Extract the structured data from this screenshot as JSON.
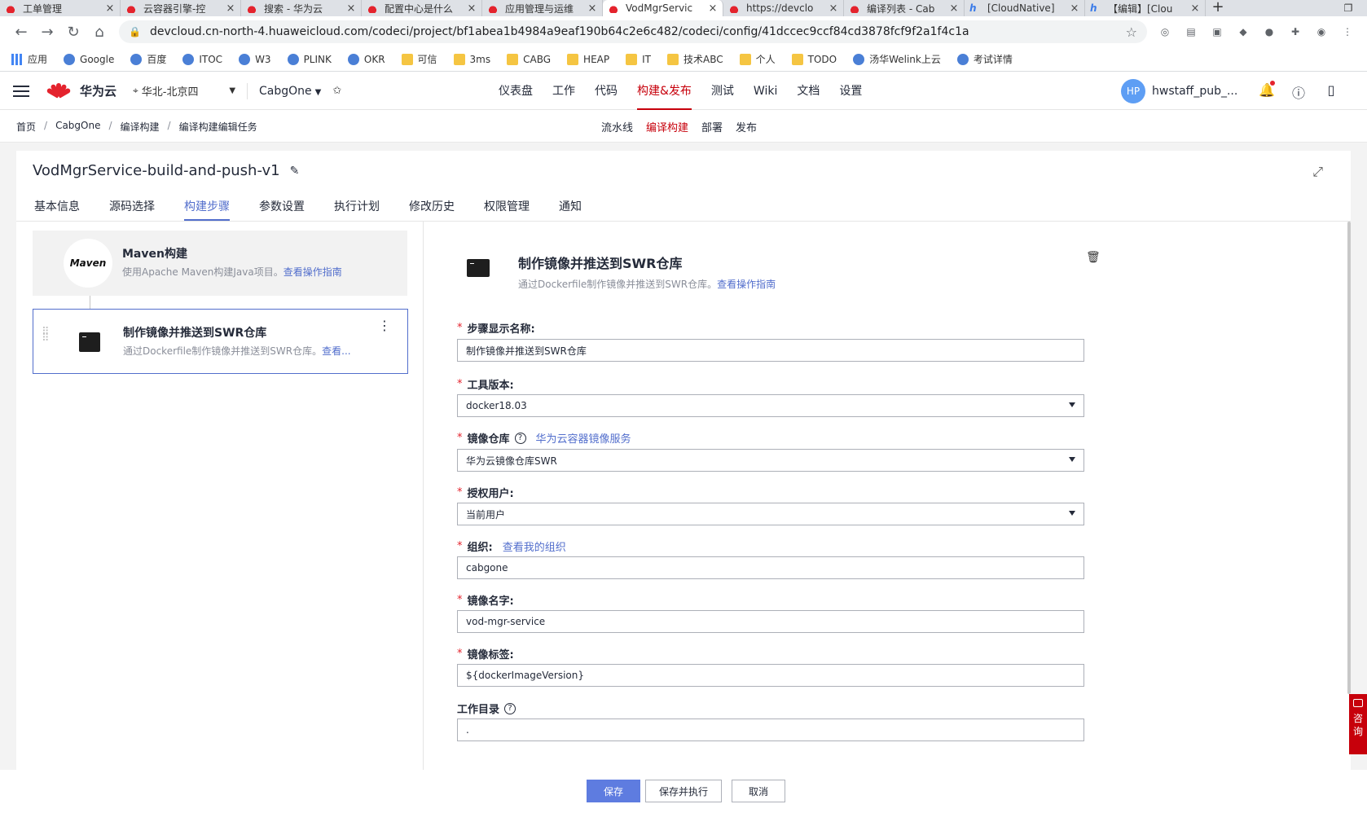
{
  "browser": {
    "tabs": [
      {
        "label": "工单管理",
        "icon": "huawei"
      },
      {
        "label": "云容器引擎-控",
        "icon": "huawei"
      },
      {
        "label": "搜索 - 华为云",
        "icon": "huawei"
      },
      {
        "label": "配置中心是什么",
        "icon": "huawei"
      },
      {
        "label": "应用管理与运维",
        "icon": "huawei"
      },
      {
        "label": "VodMgrServic",
        "icon": "huawei",
        "active": true
      },
      {
        "label": "https://devclo",
        "icon": "huawei"
      },
      {
        "label": "编译列表 - Cab",
        "icon": "huawei"
      },
      {
        "label": "[CloudNative]",
        "icon": "welink"
      },
      {
        "label": "【编辑】[Clou",
        "icon": "welink"
      }
    ],
    "url": "devcloud.cn-north-4.huaweicloud.com/codeci/project/bf1abea1b4984a9eaf190b64c2e6c482/codeci/config/41dccec9ccf84cd3878fcf9f2a1f4c1a",
    "bookmarks": [
      "应用",
      "Google",
      "百度",
      "ITOC",
      "W3",
      "PLINK",
      "OKR",
      "可信",
      "3ms",
      "CABG",
      "HEAP",
      "IT",
      "技术ABC",
      "个人",
      "TODO",
      "汤华Welink上云",
      "考试详情"
    ]
  },
  "header": {
    "brand": "华为云",
    "logo_caption": "HUAWEI",
    "region": "华北-北京四",
    "project": "CabgOne",
    "nav": [
      "仪表盘",
      "工作",
      "代码",
      "构建&发布",
      "测试",
      "Wiki",
      "文档",
      "设置"
    ],
    "nav_active": "构建&发布",
    "user_initials": "HP",
    "user_name": "hwstaff_pub_..."
  },
  "breadcrumb": [
    "首页",
    "CabgOne",
    "编译构建",
    "编译构建编辑任务"
  ],
  "subnav": [
    "流水线",
    "编译构建",
    "部署",
    "发布"
  ],
  "subnav_active": "编译构建",
  "task": {
    "title": "VodMgrService-build-and-push-v1",
    "tabs": [
      "基本信息",
      "源码选择",
      "构建步骤",
      "参数设置",
      "执行计划",
      "修改历史",
      "权限管理",
      "通知"
    ],
    "active_tab": "构建步骤"
  },
  "steps": [
    {
      "title": "Maven构建",
      "icon_text": "Maven",
      "desc": "使用Apache Maven构建Java项目。",
      "link": "查看操作指南"
    },
    {
      "title": "制作镜像并推送到SWR仓库",
      "desc": "通过Dockerfile制作镜像并推送到SWR仓库。",
      "link": "查看..."
    }
  ],
  "detail": {
    "title": "制作镜像并推送到SWR仓库",
    "desc": "通过Dockerfile制作镜像并推送到SWR仓库。",
    "link": "查看操作指南",
    "fields": {
      "step_name": {
        "label": "步骤显示名称:",
        "value": "制作镜像并推送到SWR仓库"
      },
      "tool_version": {
        "label": "工具版本:",
        "value": "docker18.03"
      },
      "repo": {
        "label": "镜像仓库",
        "link": "华为云容器镜像服务",
        "value": "华为云镜像仓库SWR"
      },
      "auth_user": {
        "label": "授权用户:",
        "value": "当前用户"
      },
      "org": {
        "label": "组织:",
        "link": "查看我的组织",
        "value": "cabgone"
      },
      "image_name": {
        "label": "镜像名字:",
        "value": "vod-mgr-service"
      },
      "image_tag": {
        "label": "镜像标签:",
        "value": "${dockerImageVersion}"
      },
      "workdir": {
        "label": "工作目录",
        "value": "."
      }
    }
  },
  "footer": {
    "save": "保存",
    "save_run": "保存并执行",
    "cancel": "取消"
  },
  "consult": [
    "咨",
    "询"
  ],
  "colors": {
    "brand_red": "#c7000b",
    "link_blue": "#526ecc",
    "primary": "#5e7ce0"
  }
}
